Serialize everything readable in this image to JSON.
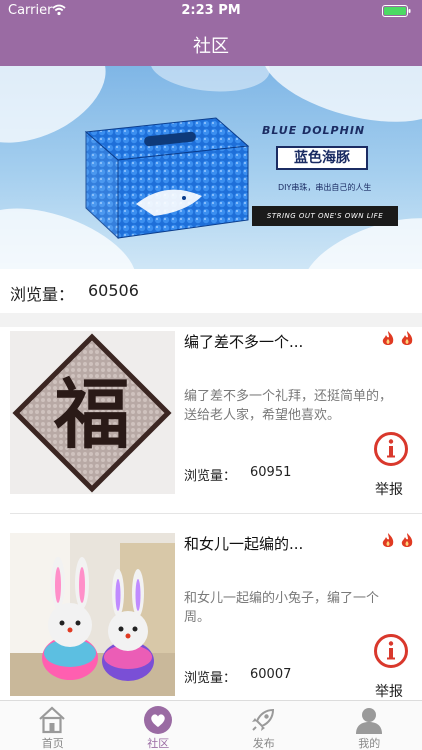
{
  "status_bar": {
    "carrier": "Carrier",
    "time": "2:23 PM",
    "wifi_icon": "wifi-icon",
    "battery_icon": "battery-icon"
  },
  "nav": {
    "title": "社区"
  },
  "banner": {
    "brand_en": "BLUE DOLPHIN",
    "brand_cn": "蓝色海豚",
    "tagline": "DIY串珠，串出自己的人生",
    "slogan": "STRING OUT ONE'S OWN LIFE"
  },
  "community_views": {
    "label": "浏览量：",
    "value": "60506"
  },
  "posts": [
    {
      "title": "编了差不多一个...",
      "description": "编了差不多一个礼拜，还挺简单的，送给老人家，希望他喜欢。",
      "views_label": "浏览量：",
      "views_value": "60951",
      "report_label": "举报",
      "thumb_char": "福"
    },
    {
      "title": "和女儿一起编的...",
      "description": "和女儿一起编的小兔子，编了一个周。",
      "views_label": "浏览量：",
      "views_value": "60007",
      "report_label": "举报"
    }
  ],
  "tabs": [
    {
      "label": "首页",
      "icon": "home-icon",
      "active": false
    },
    {
      "label": "社区",
      "icon": "heart-icon",
      "active": true
    },
    {
      "label": "发布",
      "icon": "rocket-icon",
      "active": false
    },
    {
      "label": "我的",
      "icon": "person-icon",
      "active": false
    }
  ],
  "colors": {
    "accent": "#9a6ba3",
    "report_red": "#d9382c",
    "banner_blue": "#7fb6e6"
  }
}
